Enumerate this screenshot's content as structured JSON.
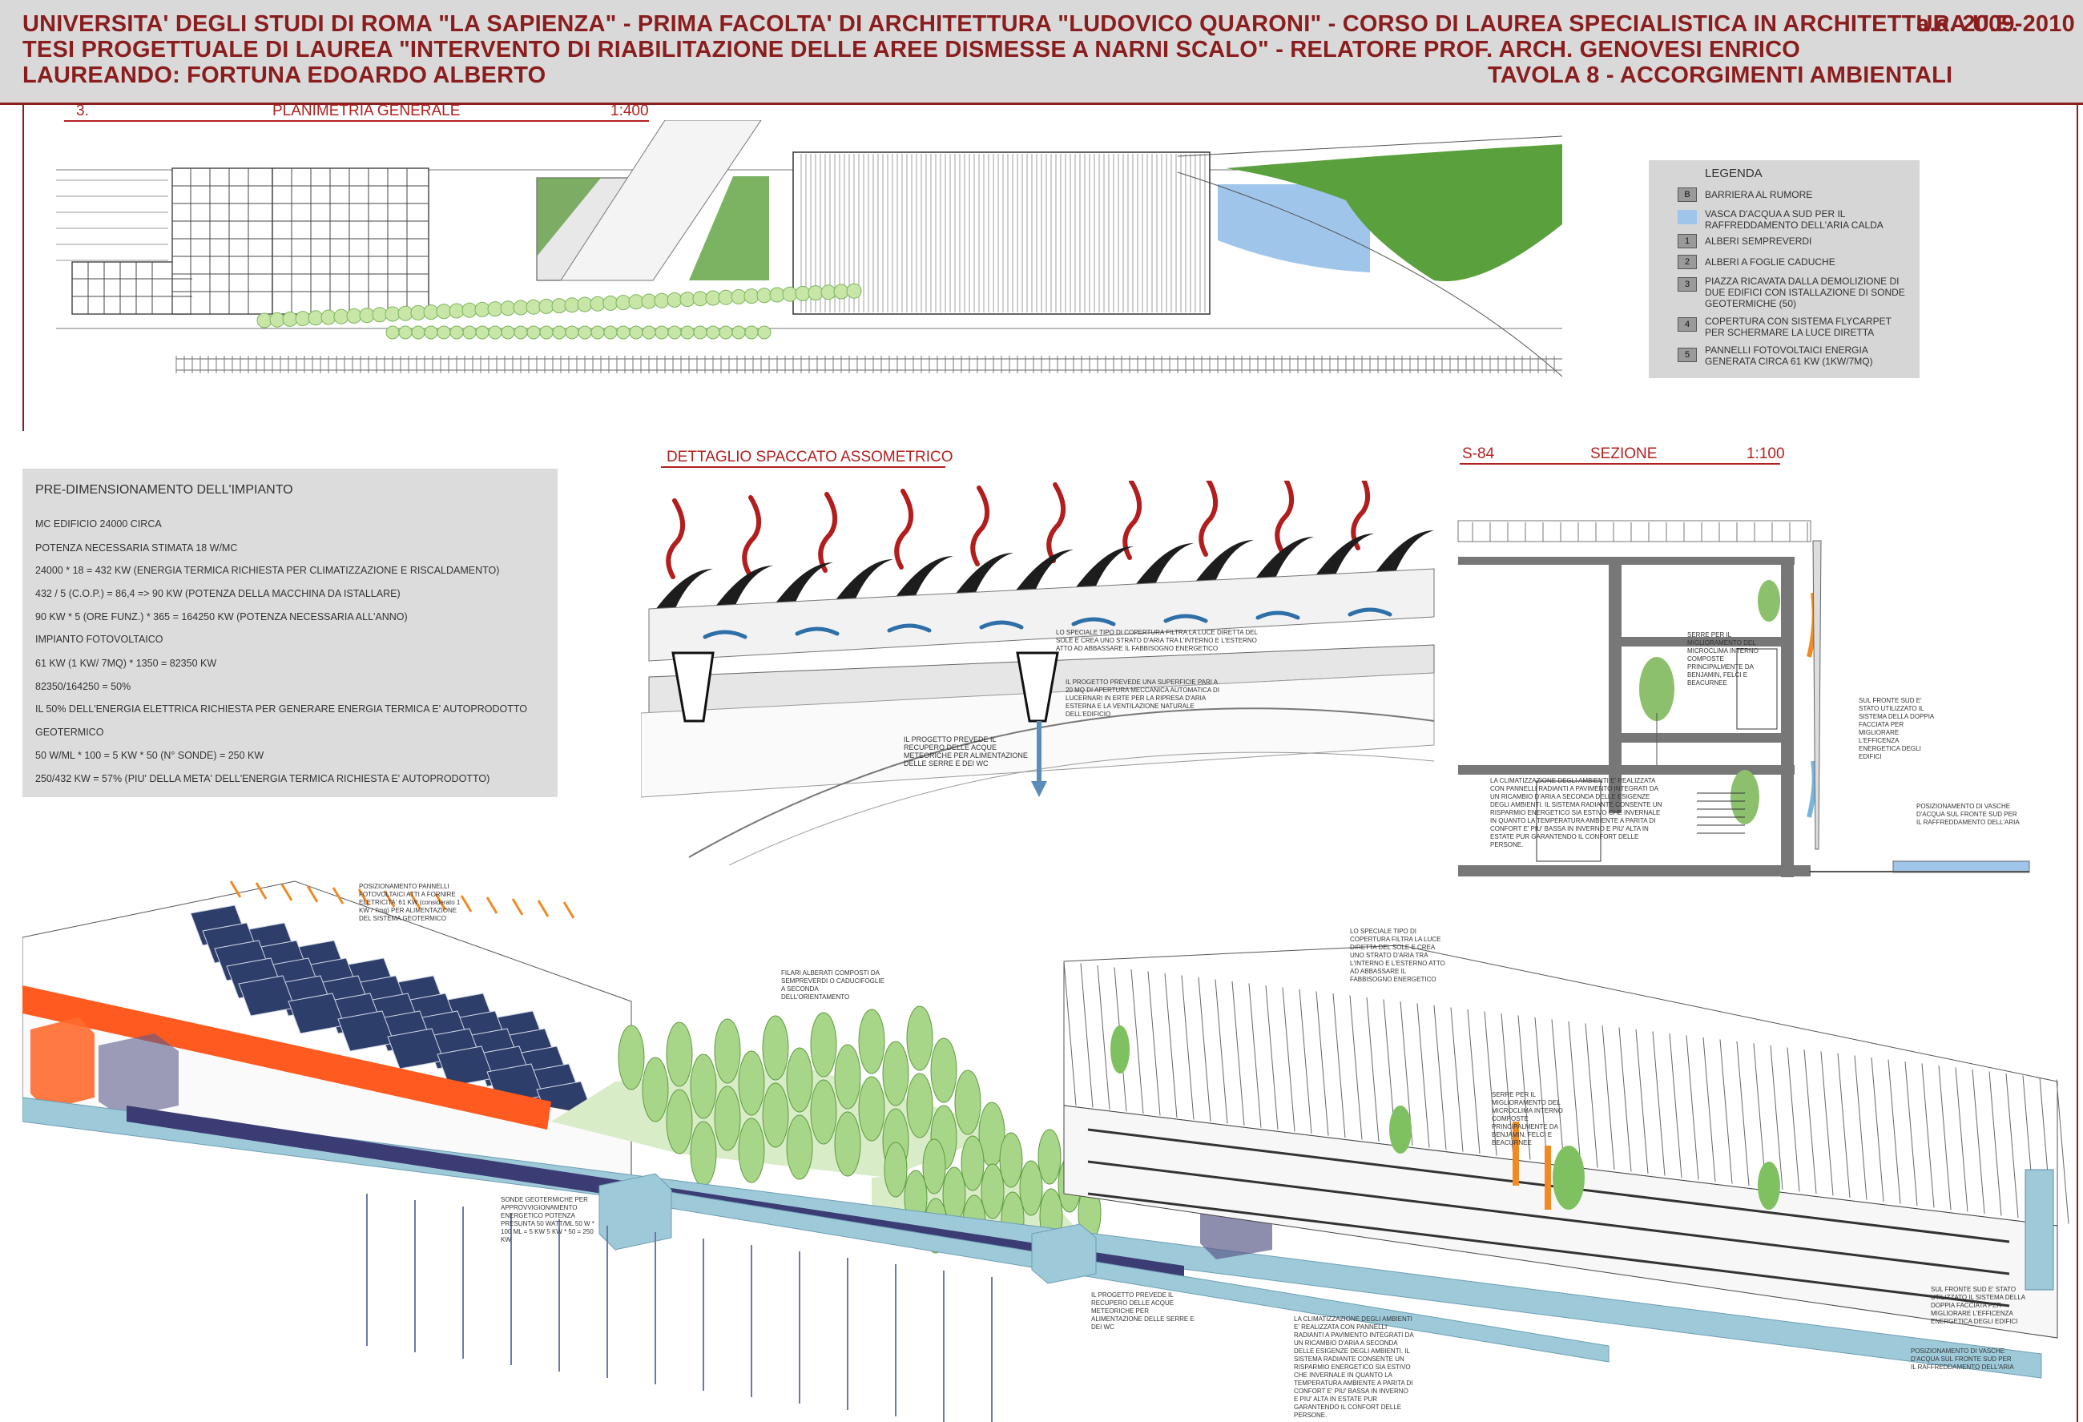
{
  "header": {
    "line1": "UNIVERSITA' DEGLI STUDI DI ROMA \"LA SAPIENZA\" - PRIMA FACOLTA' DI ARCHITETTURA \"LUDOVICO QUARONI\" - CORSO DI LAUREA SPECIALISTICA IN ARCHITETTURA U.E.",
    "year": "a.a. 2009-2010",
    "line2": "TESI PROGETTUALE DI LAUREA   \"INTERVENTO DI RIABILITAZIONE DELLE AREE DISMESSE A NARNI SCALO\" - RELATORE PROF. ARCH. GENOVESI ENRICO",
    "line3_left": "LAUREANDO: FORTUNA EDOARDO ALBERTO",
    "line3_right": "TAVOLA 8 - ACCORGIMENTI AMBIENTALI"
  },
  "plan": {
    "number": "3.",
    "title": "PLANIMETRIA GENERALE",
    "scale": "1:400"
  },
  "legend": {
    "title": "LEGENDA",
    "items": [
      {
        "key": "B",
        "text": "BARRIERA AL RUMORE"
      },
      {
        "key": "",
        "text": "VASCA D'ACQUA A SUD PER IL RAFFREDDAMENTO DELL'ARIA CALDA"
      },
      {
        "key": "1",
        "text": "ALBERI SEMPREVERDI"
      },
      {
        "key": "2",
        "text": "ALBERI A FOGLIE CADUCHE"
      },
      {
        "key": "3",
        "text": "PIAZZA RICAVATA DALLA DEMOLIZIONE DI DUE EDIFICI CON ISTALLAZIONE DI SONDE GEOTERMICHE (50)"
      },
      {
        "key": "4",
        "text": "COPERTURA CON SISTEMA FLYCARPET PER SCHERMARE LA LUCE DIRETTA"
      },
      {
        "key": "5",
        "text": "PANNELLI FOTOVOLTAICI ENERGIA GENERATA CIRCA 61 KW (1KW/7MQ)"
      }
    ],
    "colors": {
      "water": "#9fc6ea",
      "box": "#9a9a9a"
    }
  },
  "detail": {
    "title": "DETTAGLIO SPACCATO ASSOMETRICO"
  },
  "section": {
    "code": "S-84",
    "title": "SEZIONE",
    "scale": "1:100"
  },
  "calc": {
    "title": "PRE-DIMENSIONAMENTO DELL'IMPIANTO",
    "lines": [
      "MC EDIFICIO 24000 CIRCA",
      "POTENZA NECESSARIA STIMATA 18 W/MC",
      "24000 * 18 = 432 KW (ENERGIA TERMICA RICHIESTA PER CLIMATIZZAZIONE E RISCALDAMENTO)",
      "432 / 5 (C.O.P.) = 86,4 => 90 KW (POTENZA DELLA MACCHINA DA ISTALLARE)",
      "90 KW * 5 (ORE FUNZ.) * 365 = 164250 KW (POTENZA NECESSARIA ALL'ANNO)",
      "IMPIANTO FOTOVOLTAICO",
      "61 KW (1 KW/ 7MQ) * 1350 = 82350 KW",
      "82350/164250 = 50%",
      "IL 50% DELL'ENERGIA ELETTRICA RICHIESTA PER GENERARE ENERGIA TERMICA E' AUTOPRODOTTO",
      "GEOTERMICO",
      "50 W/ML * 100 = 5 KW * 50 (N° SONDE) = 250 KW",
      "250/432 KW = 57% (PIU' DELLA META' DELL'ENERGIA TERMICA RICHIESTA E' AUTOPRODOTTO)"
    ]
  },
  "notes": {
    "detail_roof": "LO SPECIALE TIPO DI COPERTURA FILTRA LA LUCE DIRETTA DEL SOLE E CREA UNO STRATO D'ARIA TRA L'INTERNO E L'ESTERNO ATTO AD ABBASSARE IL FABBISOGNO ENERGETICO",
    "detail_windows": "IL PROGETTO PREVEDE UNA SUPERFICIE PARI A 20 MQ DI APERTURA MECCANICA AUTOMATICA DI LUCERNARI IN ERTE PER LA RIPRESA D'ARIA ESTERNA E LA VENTILAZIONE NATURALE DELL'EDIFICIO",
    "detail_water": "IL PROGETTO PREVEDE IL RECUPERO DELLE ACQUE METEORICHE PER ALIMENTAZIONE DELLE SERRE E DEI WC",
    "section_greenhouse": "SERRE PER IL MIGLIORAMENTO DEL MICROCLIMA INTERNO COMPOSTE PRINCIPALMENTE DA BENJAMIN, FELCI E BEACURNEE",
    "section_facade": "SUL FRONTE SUD E' STATO UTILIZZATO IL SISTEMA DELLA DOPPIA FACCIATA PER MIGLIORARE L'EFFICENZA ENERGETICA DEGLI EDIFICI",
    "section_climate": "LA CLIMATIZZAZIONE DEGLI AMBIENTI E' REALIZZATA CON PANNELLI RADIANTI A PAVIMENTO INTEGRATI DA UN RICAMBIO D'ARIA A SECONDA DELLE ESIGENZE DEGLI AMBIENTI. IL SISTEMA RADIANTE CONSENTE UN RISPARMIO ENERGETICO SIA ESTIVO CHE INVERNALE IN QUANTO LA TEMPERATURA AMBIENTE A PARITA DI CONFORT E' PIU' BASSA IN INVERNO E PIU' ALTA IN ESTATE PUR GARANTENDO IL CONFORT DELLE PERSONE.",
    "section_pools": "POSIZIONAMENTO DI VASCHE D'ACQUA SUL FRONTE SUD PER IL RAFFREDDAMENTO DELL'ARIA",
    "axo_pv": "POSIZIONAMENTO PANNELLI FOTOVOLTAICI ATTI A FORNIRE ELETRICITA' 61 KW (considerato 1 KW / 7mq) PER ALIMENTAZIONE DEL SISTEMA GEOTERMICO",
    "axo_trees": "FILARI ALBERATI COMPOSTI DA SEMPREVERDI O CADUCIFOGLIE A SECONDA DELL'ORIENTAMENTO",
    "axo_roof": "LO SPECIALE TIPO DI COPERTURA FILTRA LA LUCE DIRETTA DEL SOLE E CREA UNO STRATO D'ARIA TRA L'INTERNO E L'ESTERNO ATTO AD ABBASSARE IL FABBISOGNO ENERGETICO",
    "axo_probes": "SONDE GEOTERMICHE PER APPROVVIGIONAMENTO ENERGETICO POTENZA PRESUNTA 50 WATT/ML 50 W * 100 ML = 5 KW 5 KW * 50 = 250 KW",
    "axo_water": "IL PROGETTO PREVEDE IL RECUPERO DELLE ACQUE METEORICHE PER ALIMENTAZIONE DELLE SERRE E DEI WC",
    "axo_climate": "LA CLIMATIZZAZIONE DEGLI AMBIENTI E' REALIZZATA CON PANNELLI RADIANTI A PAVIMENTO INTEGRATI DA UN RICAMBIO D'ARIA A SECONDA DELLE ESIGENZE DEGLI AMBIENTI. IL SISTEMA RADIANTE CONSENTE UN RISPARMIO ENERGETICO SIA ESTIVO CHE INVERNALE IN QUANTO LA TEMPERATURA AMBIENTE A PARITA DI CONFORT E' PIU' BASSA IN INVERNO E PIU' ALTA IN ESTATE PUR GARANTENDO IL CONFORT DELLE PERSONE.",
    "axo_greenhouse": "SERRE PER IL MIGLIORAMENTO DEL MICROCLIMA INTERNO COMPOSTE PRINCIPALMENTE DA BENJAMIN, FELCI E BEACURNEE",
    "axo_facade": "SUL FRONTE SUD E' STATO UTILIZZATO IL SISTEMA DELLA DOPPIA FACCIATA PER MIGLIORARE L'EFFICENZA ENERGETICA DEGLI EDIFICI",
    "axo_pools": "POSIZIONAMENTO DI VASCHE D'ACQUA SUL FRONTE SUD PER IL RAFFREDDAMENTO DELL'ARIA"
  }
}
